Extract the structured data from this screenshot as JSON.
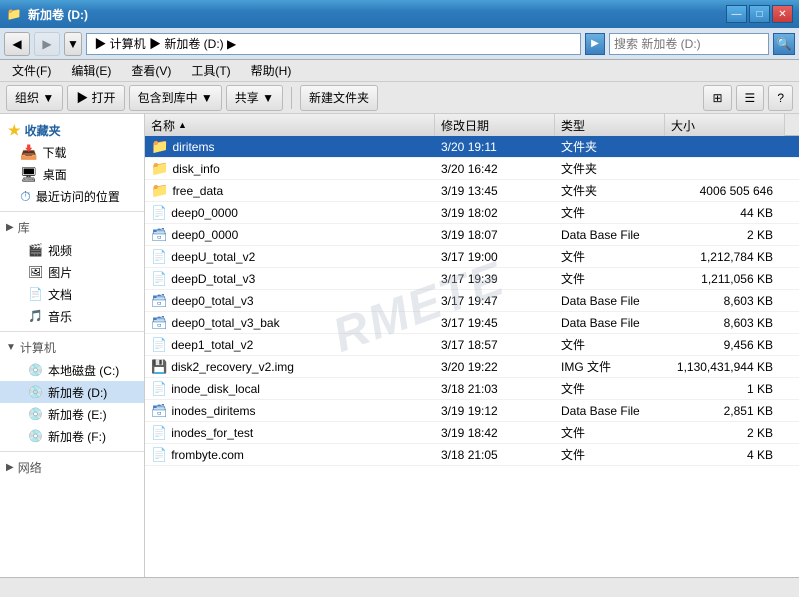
{
  "titleBar": {
    "title": "新加卷 (D:)",
    "icon": "📁",
    "minBtn": "—",
    "maxBtn": "□",
    "closeBtn": "✕"
  },
  "addressBar": {
    "navBack": "◀",
    "navForward": "▶",
    "dropArrow": "▼",
    "addressValue": " ▶ 计算机 ▶ 新加卷 (D:) ▶",
    "searchLabel": "搜索 新加卷 (D:)",
    "searchArrow": "▶",
    "searchIcon": "🔍"
  },
  "menuBar": {
    "items": [
      "文件(F)",
      "编辑(E)",
      "查看(V)",
      "工具(T)",
      "帮助(H)"
    ]
  },
  "toolbar": {
    "organize": "组织 ▼",
    "open": "▶ 打开",
    "include": "包含到库中 ▼",
    "share": "共享 ▼",
    "newFolder": "新建文件夹",
    "viewIcon1": "⊞",
    "viewIcon2": "☰",
    "helpIcon": "?"
  },
  "sidebar": {
    "favorites": "收藏夹",
    "favItems": [
      {
        "label": "下载",
        "icon": "📥"
      },
      {
        "label": "桌面",
        "icon": "🖥"
      },
      {
        "label": "最近访问的位置",
        "icon": "⏱"
      }
    ],
    "libraries": "库",
    "libItems": [
      {
        "label": "视频",
        "icon": "🎬"
      },
      {
        "label": "图片",
        "icon": "🖼"
      },
      {
        "label": "文档",
        "icon": "📄"
      },
      {
        "label": "音乐",
        "icon": "🎵"
      }
    ],
    "computer": "计算机",
    "computerItems": [
      {
        "label": "本地磁盘 (C:)",
        "icon": "💿"
      },
      {
        "label": "新加卷 (D:)",
        "icon": "💿",
        "selected": true
      },
      {
        "label": "新加卷 (E:)",
        "icon": "💿"
      },
      {
        "label": "新加卷 (F:)",
        "icon": "💿"
      }
    ],
    "network": "网络"
  },
  "fileList": {
    "columns": [
      {
        "label": "名称",
        "sortArrow": "▲"
      },
      {
        "label": "修改日期"
      },
      {
        "label": "类型"
      },
      {
        "label": "大小"
      }
    ],
    "rows": [
      {
        "name": "diritems",
        "date": "3/20 19:11",
        "type": "文件夹",
        "size": "",
        "icon": "📁",
        "iconColor": "#2060b0",
        "selected": true
      },
      {
        "name": "disk_info",
        "date": "3/20 16:42",
        "type": "文件夹",
        "size": "",
        "icon": "📁",
        "iconColor": "#e8c030"
      },
      {
        "name": "free_data",
        "date": "3/19 13:45",
        "type": "文件夹",
        "size": "4006 505 646",
        "icon": "📁",
        "iconColor": "#e8c030"
      },
      {
        "name": "deep0_0000",
        "date": "3/19 18:02",
        "type": "文件",
        "size": "44 KB",
        "icon": "📄",
        "iconColor": "#808080"
      },
      {
        "name": "deep0_0000",
        "date": "3/19 18:07",
        "type": "Data Base File",
        "size": "2 KB",
        "icon": "📄",
        "iconColor": "#4080c0"
      },
      {
        "name": "deepU_total_v2",
        "date": "3/17 19:00",
        "type": "文件",
        "size": "1,212,784 KB",
        "icon": "📄",
        "iconColor": "#808080"
      },
      {
        "name": "deepD_total_v3",
        "date": "3/17 19:39",
        "type": "文件",
        "size": "1,211,056 KB",
        "icon": "📄",
        "iconColor": "#808080"
      },
      {
        "name": "deep0_total_v3",
        "date": "3/17 19:47",
        "type": "Data Base File",
        "size": "8,603 KB",
        "icon": "📄",
        "iconColor": "#4080c0"
      },
      {
        "name": "deep0_total_v3_bak",
        "date": "3/17 19:45",
        "type": "Data Base File",
        "size": "8,603 KB",
        "icon": "📄",
        "iconColor": "#4080c0"
      },
      {
        "name": "deep1_total_v2",
        "date": "3/17 18:57",
        "type": "文件",
        "size": "9,456 KB",
        "icon": "📄",
        "iconColor": "#808080"
      },
      {
        "name": "disk2_recovery_v2.img",
        "date": "3/20 19:22",
        "type": "IMG 文件",
        "size": "1,130,431,944 KB",
        "icon": "📄",
        "iconColor": "#606060"
      },
      {
        "name": "inode_disk_local",
        "date": "3/18 21:03",
        "type": "文件",
        "size": "1 KB",
        "icon": "📄",
        "iconColor": "#808080"
      },
      {
        "name": "inodes_diritems",
        "date": "3/19 19:12",
        "type": "Data Base File",
        "size": "2,851 KB",
        "icon": "📄",
        "iconColor": "#4080c0"
      },
      {
        "name": "inodes_for_test",
        "date": "3/19 18:42",
        "type": "文件",
        "size": "2 KB",
        "icon": "📄",
        "iconColor": "#808080"
      },
      {
        "name": "frombyte.com",
        "date": "3/18 21:05",
        "type": "文件",
        "size": "4 KB",
        "icon": "📄",
        "iconColor": "#808080"
      }
    ]
  },
  "statusBar": {
    "text": ""
  },
  "watermark": "RMETE"
}
